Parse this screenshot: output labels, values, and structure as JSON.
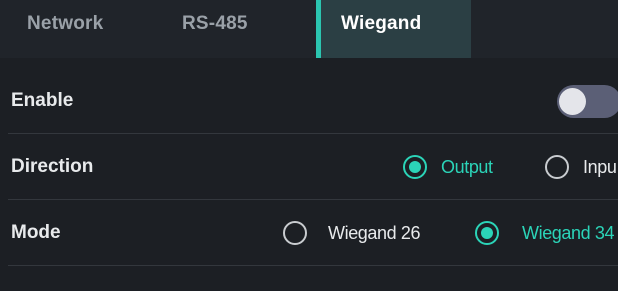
{
  "tabs": {
    "network": "Network",
    "rs485": "RS-485",
    "wiegand": "Wiegand",
    "active": "Wiegand"
  },
  "settings": {
    "enable": {
      "label": "Enable",
      "value": false
    },
    "direction": {
      "label": "Direction",
      "options": [
        "Output",
        "Inpu"
      ],
      "selected": "Output"
    },
    "mode": {
      "label": "Mode",
      "options": [
        "Wiegand 26",
        "Wiegand 34"
      ],
      "selected": "Wiegand 34"
    }
  },
  "colors": {
    "background": "#1c1f24",
    "accent": "#2bd4b8",
    "active_tab_bg": "#2b3f44",
    "toggle_off": "#5b5f76"
  }
}
